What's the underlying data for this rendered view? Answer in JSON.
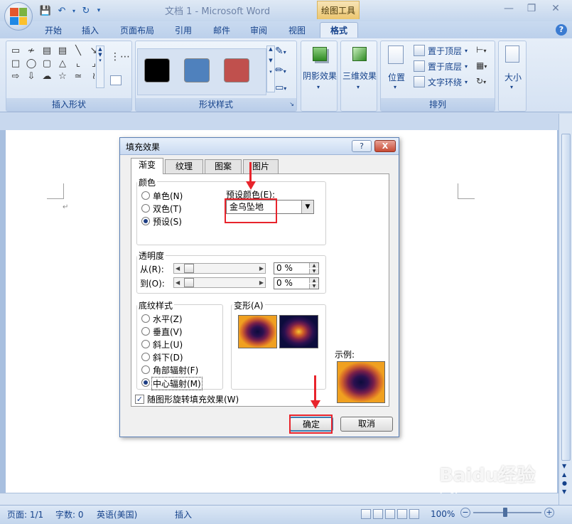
{
  "window": {
    "title": "文档 1 - Microsoft Word",
    "context_tab": "绘图工具"
  },
  "tabs": [
    {
      "label": "开始"
    },
    {
      "label": "插入"
    },
    {
      "label": "页面布局"
    },
    {
      "label": "引用"
    },
    {
      "label": "邮件"
    },
    {
      "label": "审阅"
    },
    {
      "label": "视图"
    },
    {
      "label": "格式"
    }
  ],
  "ribbon": {
    "insert_shapes_label": "插入形状",
    "shape_styles_label": "形状样式",
    "arrange_label": "排列",
    "shadow_label": "阴影效果",
    "threed_label": "三维效果",
    "position_label": "位置",
    "bring_front": "置于顶层",
    "send_back": "置于底层",
    "text_wrap": "文字环绕",
    "size_label": "大小",
    "style_swatches": [
      "#000000",
      "#4f81bd",
      "#c0504d"
    ]
  },
  "dialog": {
    "title": "填充效果",
    "help_btn": "?",
    "close_btn": "X",
    "tabs": [
      "渐变",
      "纹理",
      "图案",
      "图片"
    ],
    "color_group": "颜色",
    "color_options": [
      "单色(N)",
      "双色(T)",
      "预设(S)"
    ],
    "preset_label": "预设颜色(E):",
    "preset_value": "金乌坠地",
    "transparency_group": "透明度",
    "from_label": "从(R):",
    "to_label": "到(O):",
    "from_value": "0 %",
    "to_value": "0 %",
    "shading_group": "底纹样式",
    "shading_options": [
      "水平(Z)",
      "垂直(V)",
      "斜上(U)",
      "斜下(D)",
      "角部辐射(F)",
      "中心辐射(M)"
    ],
    "variants_label": "变形(A)",
    "sample_label": "示例:",
    "rotate_checkbox": "随图形旋转填充效果(W)",
    "ok": "确定",
    "cancel": "取消"
  },
  "status": {
    "page": "页面: 1/1",
    "words": "字数: 0",
    "language": "英语(美国)",
    "mode": "插入",
    "zoom": "100%"
  },
  "watermark": {
    "text": "Baidu经验",
    "url": "jingyan.baidu.com"
  }
}
